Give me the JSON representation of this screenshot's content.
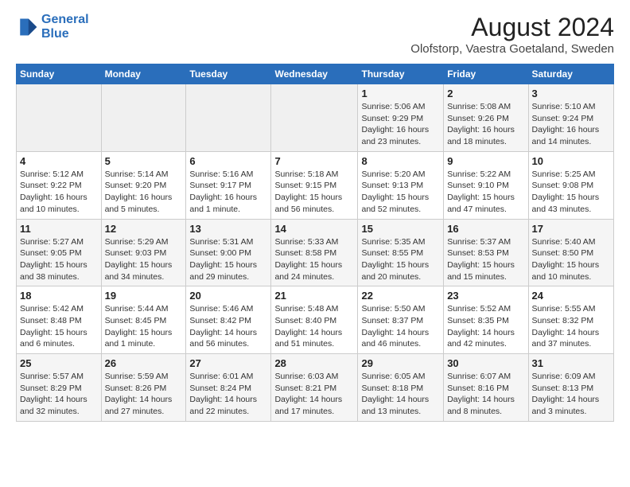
{
  "header": {
    "logo_line1": "General",
    "logo_line2": "Blue",
    "title": "August 2024",
    "subtitle": "Olofstorp, Vaestra Goetaland, Sweden"
  },
  "days_of_week": [
    "Sunday",
    "Monday",
    "Tuesday",
    "Wednesday",
    "Thursday",
    "Friday",
    "Saturday"
  ],
  "weeks": [
    [
      {
        "day": "",
        "info": ""
      },
      {
        "day": "",
        "info": ""
      },
      {
        "day": "",
        "info": ""
      },
      {
        "day": "",
        "info": ""
      },
      {
        "day": "1",
        "info": "Sunrise: 5:06 AM\nSunset: 9:29 PM\nDaylight: 16 hours and 23 minutes."
      },
      {
        "day": "2",
        "info": "Sunrise: 5:08 AM\nSunset: 9:26 PM\nDaylight: 16 hours and 18 minutes."
      },
      {
        "day": "3",
        "info": "Sunrise: 5:10 AM\nSunset: 9:24 PM\nDaylight: 16 hours and 14 minutes."
      }
    ],
    [
      {
        "day": "4",
        "info": "Sunrise: 5:12 AM\nSunset: 9:22 PM\nDaylight: 16 hours and 10 minutes."
      },
      {
        "day": "5",
        "info": "Sunrise: 5:14 AM\nSunset: 9:20 PM\nDaylight: 16 hours and 5 minutes."
      },
      {
        "day": "6",
        "info": "Sunrise: 5:16 AM\nSunset: 9:17 PM\nDaylight: 16 hours and 1 minute."
      },
      {
        "day": "7",
        "info": "Sunrise: 5:18 AM\nSunset: 9:15 PM\nDaylight: 15 hours and 56 minutes."
      },
      {
        "day": "8",
        "info": "Sunrise: 5:20 AM\nSunset: 9:13 PM\nDaylight: 15 hours and 52 minutes."
      },
      {
        "day": "9",
        "info": "Sunrise: 5:22 AM\nSunset: 9:10 PM\nDaylight: 15 hours and 47 minutes."
      },
      {
        "day": "10",
        "info": "Sunrise: 5:25 AM\nSunset: 9:08 PM\nDaylight: 15 hours and 43 minutes."
      }
    ],
    [
      {
        "day": "11",
        "info": "Sunrise: 5:27 AM\nSunset: 9:05 PM\nDaylight: 15 hours and 38 minutes."
      },
      {
        "day": "12",
        "info": "Sunrise: 5:29 AM\nSunset: 9:03 PM\nDaylight: 15 hours and 34 minutes."
      },
      {
        "day": "13",
        "info": "Sunrise: 5:31 AM\nSunset: 9:00 PM\nDaylight: 15 hours and 29 minutes."
      },
      {
        "day": "14",
        "info": "Sunrise: 5:33 AM\nSunset: 8:58 PM\nDaylight: 15 hours and 24 minutes."
      },
      {
        "day": "15",
        "info": "Sunrise: 5:35 AM\nSunset: 8:55 PM\nDaylight: 15 hours and 20 minutes."
      },
      {
        "day": "16",
        "info": "Sunrise: 5:37 AM\nSunset: 8:53 PM\nDaylight: 15 hours and 15 minutes."
      },
      {
        "day": "17",
        "info": "Sunrise: 5:40 AM\nSunset: 8:50 PM\nDaylight: 15 hours and 10 minutes."
      }
    ],
    [
      {
        "day": "18",
        "info": "Sunrise: 5:42 AM\nSunset: 8:48 PM\nDaylight: 15 hours and 6 minutes."
      },
      {
        "day": "19",
        "info": "Sunrise: 5:44 AM\nSunset: 8:45 PM\nDaylight: 15 hours and 1 minute."
      },
      {
        "day": "20",
        "info": "Sunrise: 5:46 AM\nSunset: 8:42 PM\nDaylight: 14 hours and 56 minutes."
      },
      {
        "day": "21",
        "info": "Sunrise: 5:48 AM\nSunset: 8:40 PM\nDaylight: 14 hours and 51 minutes."
      },
      {
        "day": "22",
        "info": "Sunrise: 5:50 AM\nSunset: 8:37 PM\nDaylight: 14 hours and 46 minutes."
      },
      {
        "day": "23",
        "info": "Sunrise: 5:52 AM\nSunset: 8:35 PM\nDaylight: 14 hours and 42 minutes."
      },
      {
        "day": "24",
        "info": "Sunrise: 5:55 AM\nSunset: 8:32 PM\nDaylight: 14 hours and 37 minutes."
      }
    ],
    [
      {
        "day": "25",
        "info": "Sunrise: 5:57 AM\nSunset: 8:29 PM\nDaylight: 14 hours and 32 minutes."
      },
      {
        "day": "26",
        "info": "Sunrise: 5:59 AM\nSunset: 8:26 PM\nDaylight: 14 hours and 27 minutes."
      },
      {
        "day": "27",
        "info": "Sunrise: 6:01 AM\nSunset: 8:24 PM\nDaylight: 14 hours and 22 minutes."
      },
      {
        "day": "28",
        "info": "Sunrise: 6:03 AM\nSunset: 8:21 PM\nDaylight: 14 hours and 17 minutes."
      },
      {
        "day": "29",
        "info": "Sunrise: 6:05 AM\nSunset: 8:18 PM\nDaylight: 14 hours and 13 minutes."
      },
      {
        "day": "30",
        "info": "Sunrise: 6:07 AM\nSunset: 8:16 PM\nDaylight: 14 hours and 8 minutes."
      },
      {
        "day": "31",
        "info": "Sunrise: 6:09 AM\nSunset: 8:13 PM\nDaylight: 14 hours and 3 minutes."
      }
    ]
  ]
}
